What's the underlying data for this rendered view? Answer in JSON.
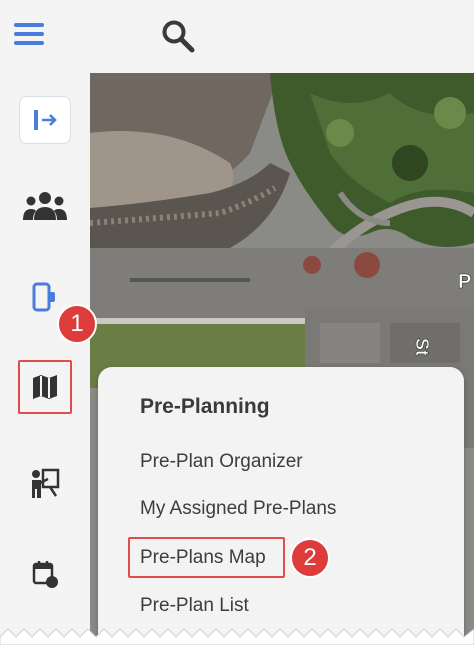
{
  "topbar": {
    "menu_icon": "hamburger-menu-icon",
    "search_icon": "search-icon"
  },
  "sidebar": {
    "items": [
      {
        "icon": "logout-arrow-icon"
      },
      {
        "icon": "people-group-icon"
      },
      {
        "icon": "device-tablet-icon"
      },
      {
        "icon": "map-icon"
      },
      {
        "icon": "presenter-board-icon"
      },
      {
        "icon": "calendar-event-icon"
      }
    ]
  },
  "menu": {
    "title": "Pre-Planning",
    "items": [
      "Pre-Plan Organizer",
      "My Assigned Pre-Plans",
      "Pre-Plans Map",
      "Pre-Plan List"
    ]
  },
  "callouts": {
    "first": "1",
    "second": "2"
  },
  "map": {
    "label_p": "P",
    "label_st": "St"
  },
  "colors": {
    "accent": "#4a7cdc",
    "callout": "#de3b3b"
  }
}
